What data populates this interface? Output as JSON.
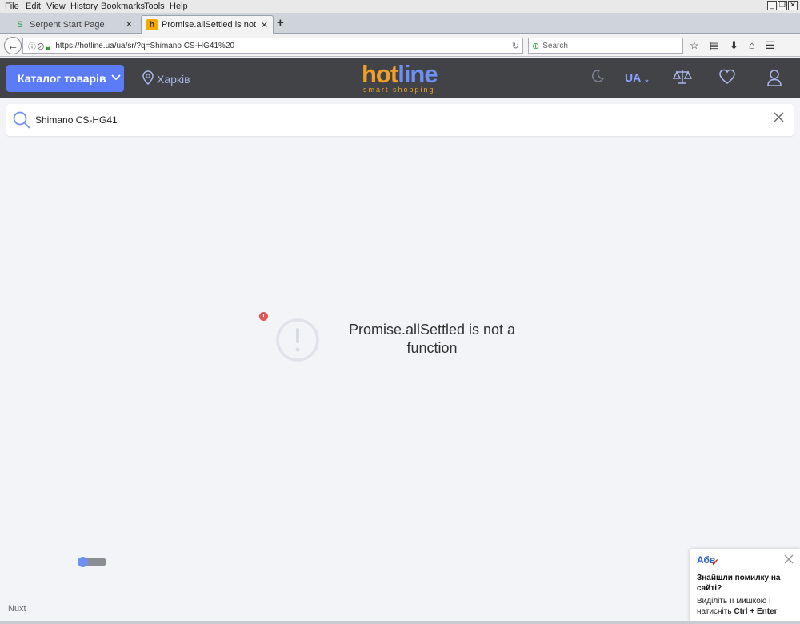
{
  "browser": {
    "menu": [
      "File",
      "Edit",
      "View",
      "History",
      "Bookmarks",
      "Tools",
      "Help"
    ],
    "tabs": [
      {
        "label": "Serpent Start Page",
        "icon": "serpent-icon"
      },
      {
        "label": "Promise.allSettled is not a functio",
        "icon": "hotline-favicon"
      }
    ],
    "url": "https://hotline.ua/ua/sr/?q=Shimano CS-HG41%20",
    "url_domain": "hotline.ua",
    "search_placeholder": "Search"
  },
  "header": {
    "catalog_label": "Каталог товарів",
    "city": "Харків",
    "logo_hot": "hot",
    "logo_line": "line",
    "logo_tagline": "smart shopping",
    "lang": "UA",
    "accent": "#5b7cf6",
    "header_bg": "#414347"
  },
  "search": {
    "value": "Shimano CS-HG41"
  },
  "error": {
    "message": "Promise.allSettled is not a function"
  },
  "footer": {
    "framework": "Nuxt"
  },
  "feedback": {
    "logo": "Абв",
    "title": "Знайшли помилку на сайті?",
    "text_prefix": "Виділіть її мишкою і натисніть ",
    "shortcut": "Ctrl + Enter"
  }
}
